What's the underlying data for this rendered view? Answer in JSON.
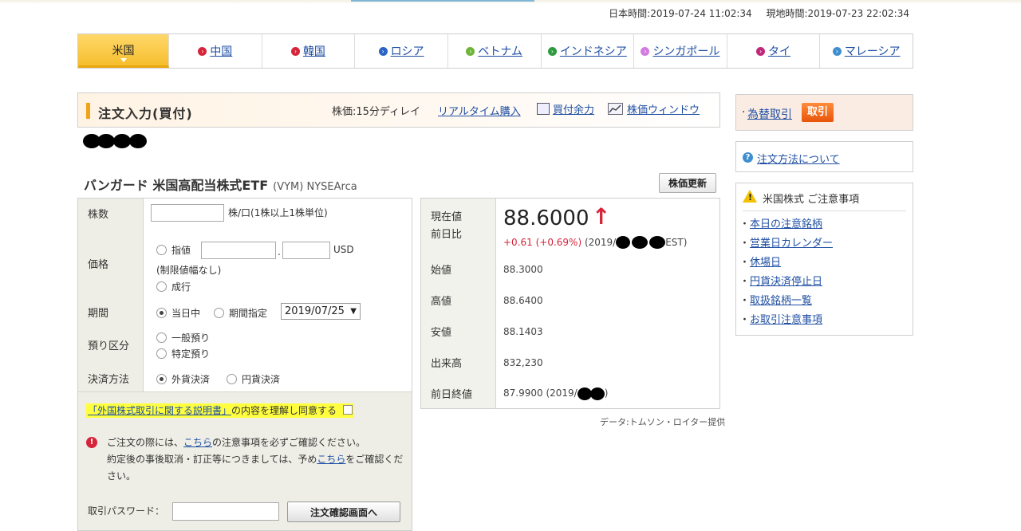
{
  "time": {
    "japan": "日本時間:2019-07-24 11:02:34",
    "local": "現地時間:2019-07-23 22:02:34"
  },
  "tabs": [
    {
      "label": "米国",
      "active": true,
      "color": ""
    },
    {
      "label": "中国",
      "color": "#d6243a"
    },
    {
      "label": "韓国",
      "color": "#d6243a"
    },
    {
      "label": "ロシア",
      "color": "#2b64c4"
    },
    {
      "label": "ベトナム",
      "color": "#6fb43a"
    },
    {
      "label": "インドネシア",
      "color": "#2e9a3e"
    },
    {
      "label": "シンガポール",
      "color": "#d27be0"
    },
    {
      "label": "タイ",
      "color": "#c0287a"
    },
    {
      "label": "マレーシア",
      "color": "#3f8fd0"
    }
  ],
  "order_header": {
    "title": "注文入力(買付)",
    "delay": "株価:15分ディレイ",
    "realtime": "リアルタイム購入",
    "buying_power": "買付余力",
    "price_window": "株価ウィンドウ"
  },
  "security": {
    "name": "バンガード 米国高配当株式ETF",
    "code": "(VYM) NYSEArca",
    "refresh_label": "株価更新"
  },
  "form": {
    "qty_label": "株数",
    "qty_unit": "株/口(1株以上1株単位)",
    "price_label": "価格",
    "limit_label": "指値",
    "currency": "USD",
    "limit_note": "(制限値幅なし)",
    "market_label": "成行",
    "period_label": "期間",
    "today_label": "当日中",
    "period_specify_label": "期間指定",
    "date_value": "2019/07/25",
    "custody_label": "預り区分",
    "general_label": "一般預り",
    "specific_label": "特定預り",
    "settlement_label": "決済方法",
    "fx_settle_label": "外貨決済",
    "yen_settle_label": "円貨決済",
    "agree_link": "「外国株式取引に関する説明書」",
    "agree_text": "の内容を理解し同意する",
    "notice_1a": "ご注文の際には、",
    "notice_1link": "こちら",
    "notice_1b": "の注意事項を必ずご確認ください。",
    "notice_2a": "約定後の事後取消・訂正等につきましては、予め",
    "notice_2link": "こちら",
    "notice_2b": "をご確認ください。",
    "password_label": "取引パスワード：",
    "confirm_button": "注文確認画面へ"
  },
  "quote": {
    "current_label": "現在値",
    "change_label": "前日比",
    "price": "88.6000",
    "change": "+0.61 (+0.69%)",
    "change_time": " (2019/",
    "change_tz": "EST)",
    "open_label": "始値",
    "open": "88.3000",
    "high_label": "高値",
    "high": "88.6400",
    "low_label": "安値",
    "low": "88.1403",
    "volume_label": "出来高",
    "volume": "832,230",
    "prev_close_label": "前日終値",
    "prev_close": "87.9900 (2019/",
    "provider": "データ:トムソン・ロイター提供"
  },
  "sidebar": {
    "fx_link": "為替取引",
    "fx_button": "取引",
    "howto": "注文方法について",
    "caution_title": "米国株式 ご注意事項",
    "links": [
      "本日の注意銘柄",
      "営業日カレンダー",
      "休場日",
      "円貨決済停止日",
      "取扱銘柄一覧",
      "お取引注意事項"
    ]
  }
}
